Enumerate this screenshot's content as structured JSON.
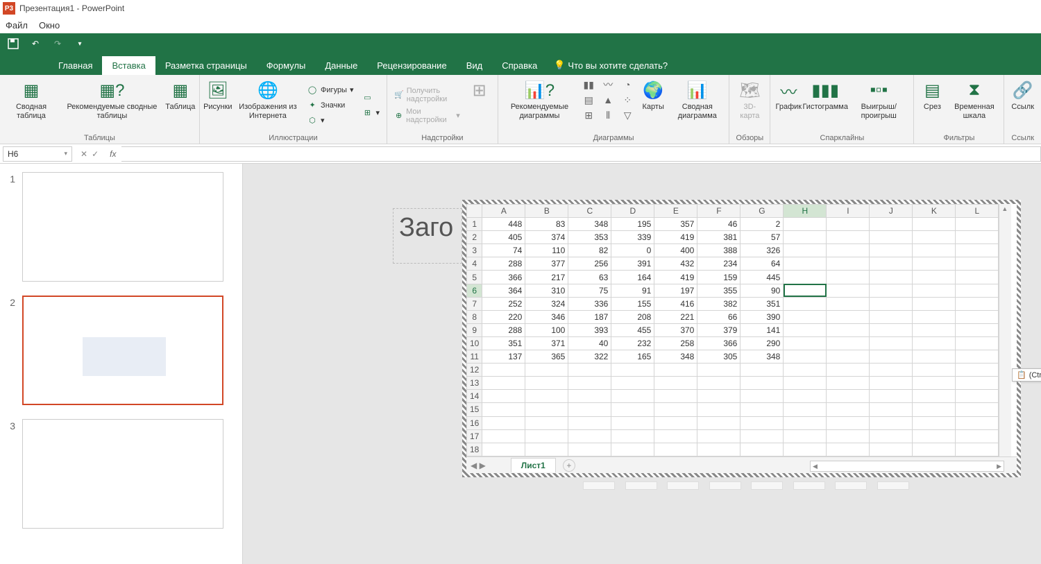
{
  "app": {
    "icon_text": "P3",
    "title": "Презентация1 - PowerPoint"
  },
  "menus": {
    "file": "Файл",
    "window": "Окно"
  },
  "ribbon_tabs": {
    "home": "Главная",
    "insert": "Вставка",
    "layout": "Разметка страницы",
    "formulas": "Формулы",
    "data": "Данные",
    "review": "Рецензирование",
    "view": "Вид",
    "help": "Справка",
    "tell_me": "Что вы хотите сделать?"
  },
  "ribbon_groups": {
    "tables": {
      "label": "Таблицы",
      "pivot": "Сводная\nтаблица",
      "reco_pivot": "Рекомендуемые\nсводные таблицы",
      "table": "Таблица"
    },
    "illustrations": {
      "label": "Иллюстрации",
      "pictures": "Рисунки",
      "online_pics": "Изображения\nиз Интернета",
      "shapes": "Фигуры",
      "icons": "Значки"
    },
    "addins": {
      "label": "Надстройки",
      "get": "Получить надстройки",
      "my": "Мои надстройки"
    },
    "charts": {
      "label": "Диаграммы",
      "reco": "Рекомендуемые\nдиаграммы",
      "maps": "Карты",
      "pivot_chart": "Сводная\nдиаграмма"
    },
    "tours": {
      "label": "Обзоры",
      "map3d": "3D-\nкарта"
    },
    "sparklines": {
      "label": "Спарклайны",
      "line": "График",
      "column": "Гистограмма",
      "winloss": "Выигрыш/\nпроигрыш"
    },
    "filters": {
      "label": "Фильтры",
      "slicer": "Срез",
      "timeline": "Временная\nшкала"
    },
    "links": {
      "label": "Ссылк",
      "link": "Ссылк"
    }
  },
  "name_box": "H6",
  "slide_numbers": [
    "1",
    "2",
    "3"
  ],
  "title_placeholder": "Заго",
  "columns": [
    "A",
    "B",
    "C",
    "D",
    "E",
    "F",
    "G",
    "H",
    "I",
    "J",
    "K",
    "L"
  ],
  "rows": [
    "1",
    "2",
    "3",
    "4",
    "5",
    "6",
    "7",
    "8",
    "9",
    "10",
    "11",
    "12",
    "13",
    "14",
    "15",
    "16",
    "17",
    "18"
  ],
  "selected_cell": {
    "row": 6,
    "col": "H"
  },
  "sheet_tab": "Лист1",
  "paste_label": "(Ctrl)",
  "chart_data": {
    "type": "table",
    "columns": [
      "A",
      "B",
      "C",
      "D",
      "E",
      "F",
      "G"
    ],
    "rows": [
      [
        448,
        83,
        348,
        195,
        357,
        46,
        2
      ],
      [
        405,
        374,
        353,
        339,
        419,
        381,
        57
      ],
      [
        74,
        110,
        82,
        0,
        400,
        388,
        326
      ],
      [
        288,
        377,
        256,
        391,
        432,
        234,
        64
      ],
      [
        366,
        217,
        63,
        164,
        419,
        159,
        445
      ],
      [
        364,
        310,
        75,
        91,
        197,
        355,
        90
      ],
      [
        252,
        324,
        336,
        155,
        416,
        382,
        351
      ],
      [
        220,
        346,
        187,
        208,
        221,
        66,
        390
      ],
      [
        288,
        100,
        393,
        455,
        370,
        379,
        141
      ],
      [
        351,
        371,
        40,
        232,
        258,
        366,
        290
      ],
      [
        137,
        365,
        322,
        165,
        348,
        305,
        348
      ]
    ]
  }
}
